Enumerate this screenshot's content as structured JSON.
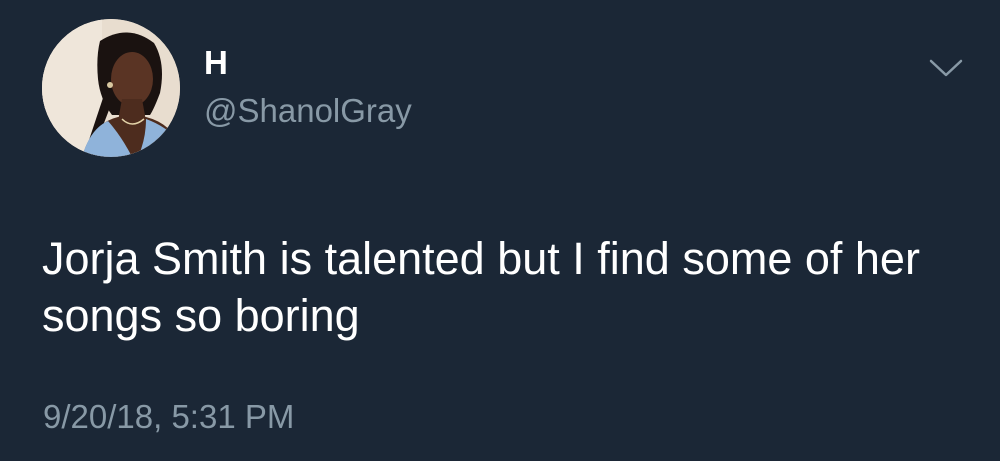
{
  "tweet": {
    "author": {
      "display_name": "H",
      "handle": "@ShanolGray",
      "avatar_icon": "profile-photo"
    },
    "menu_icon": "chevron-down-icon",
    "text": "Jorja Smith is talented but I find some of her songs so boring",
    "timestamp": "9/20/18, 5:31 PM"
  },
  "colors": {
    "background": "#1b2736",
    "primary_text": "#ffffff",
    "secondary_text": "#8899a6"
  }
}
